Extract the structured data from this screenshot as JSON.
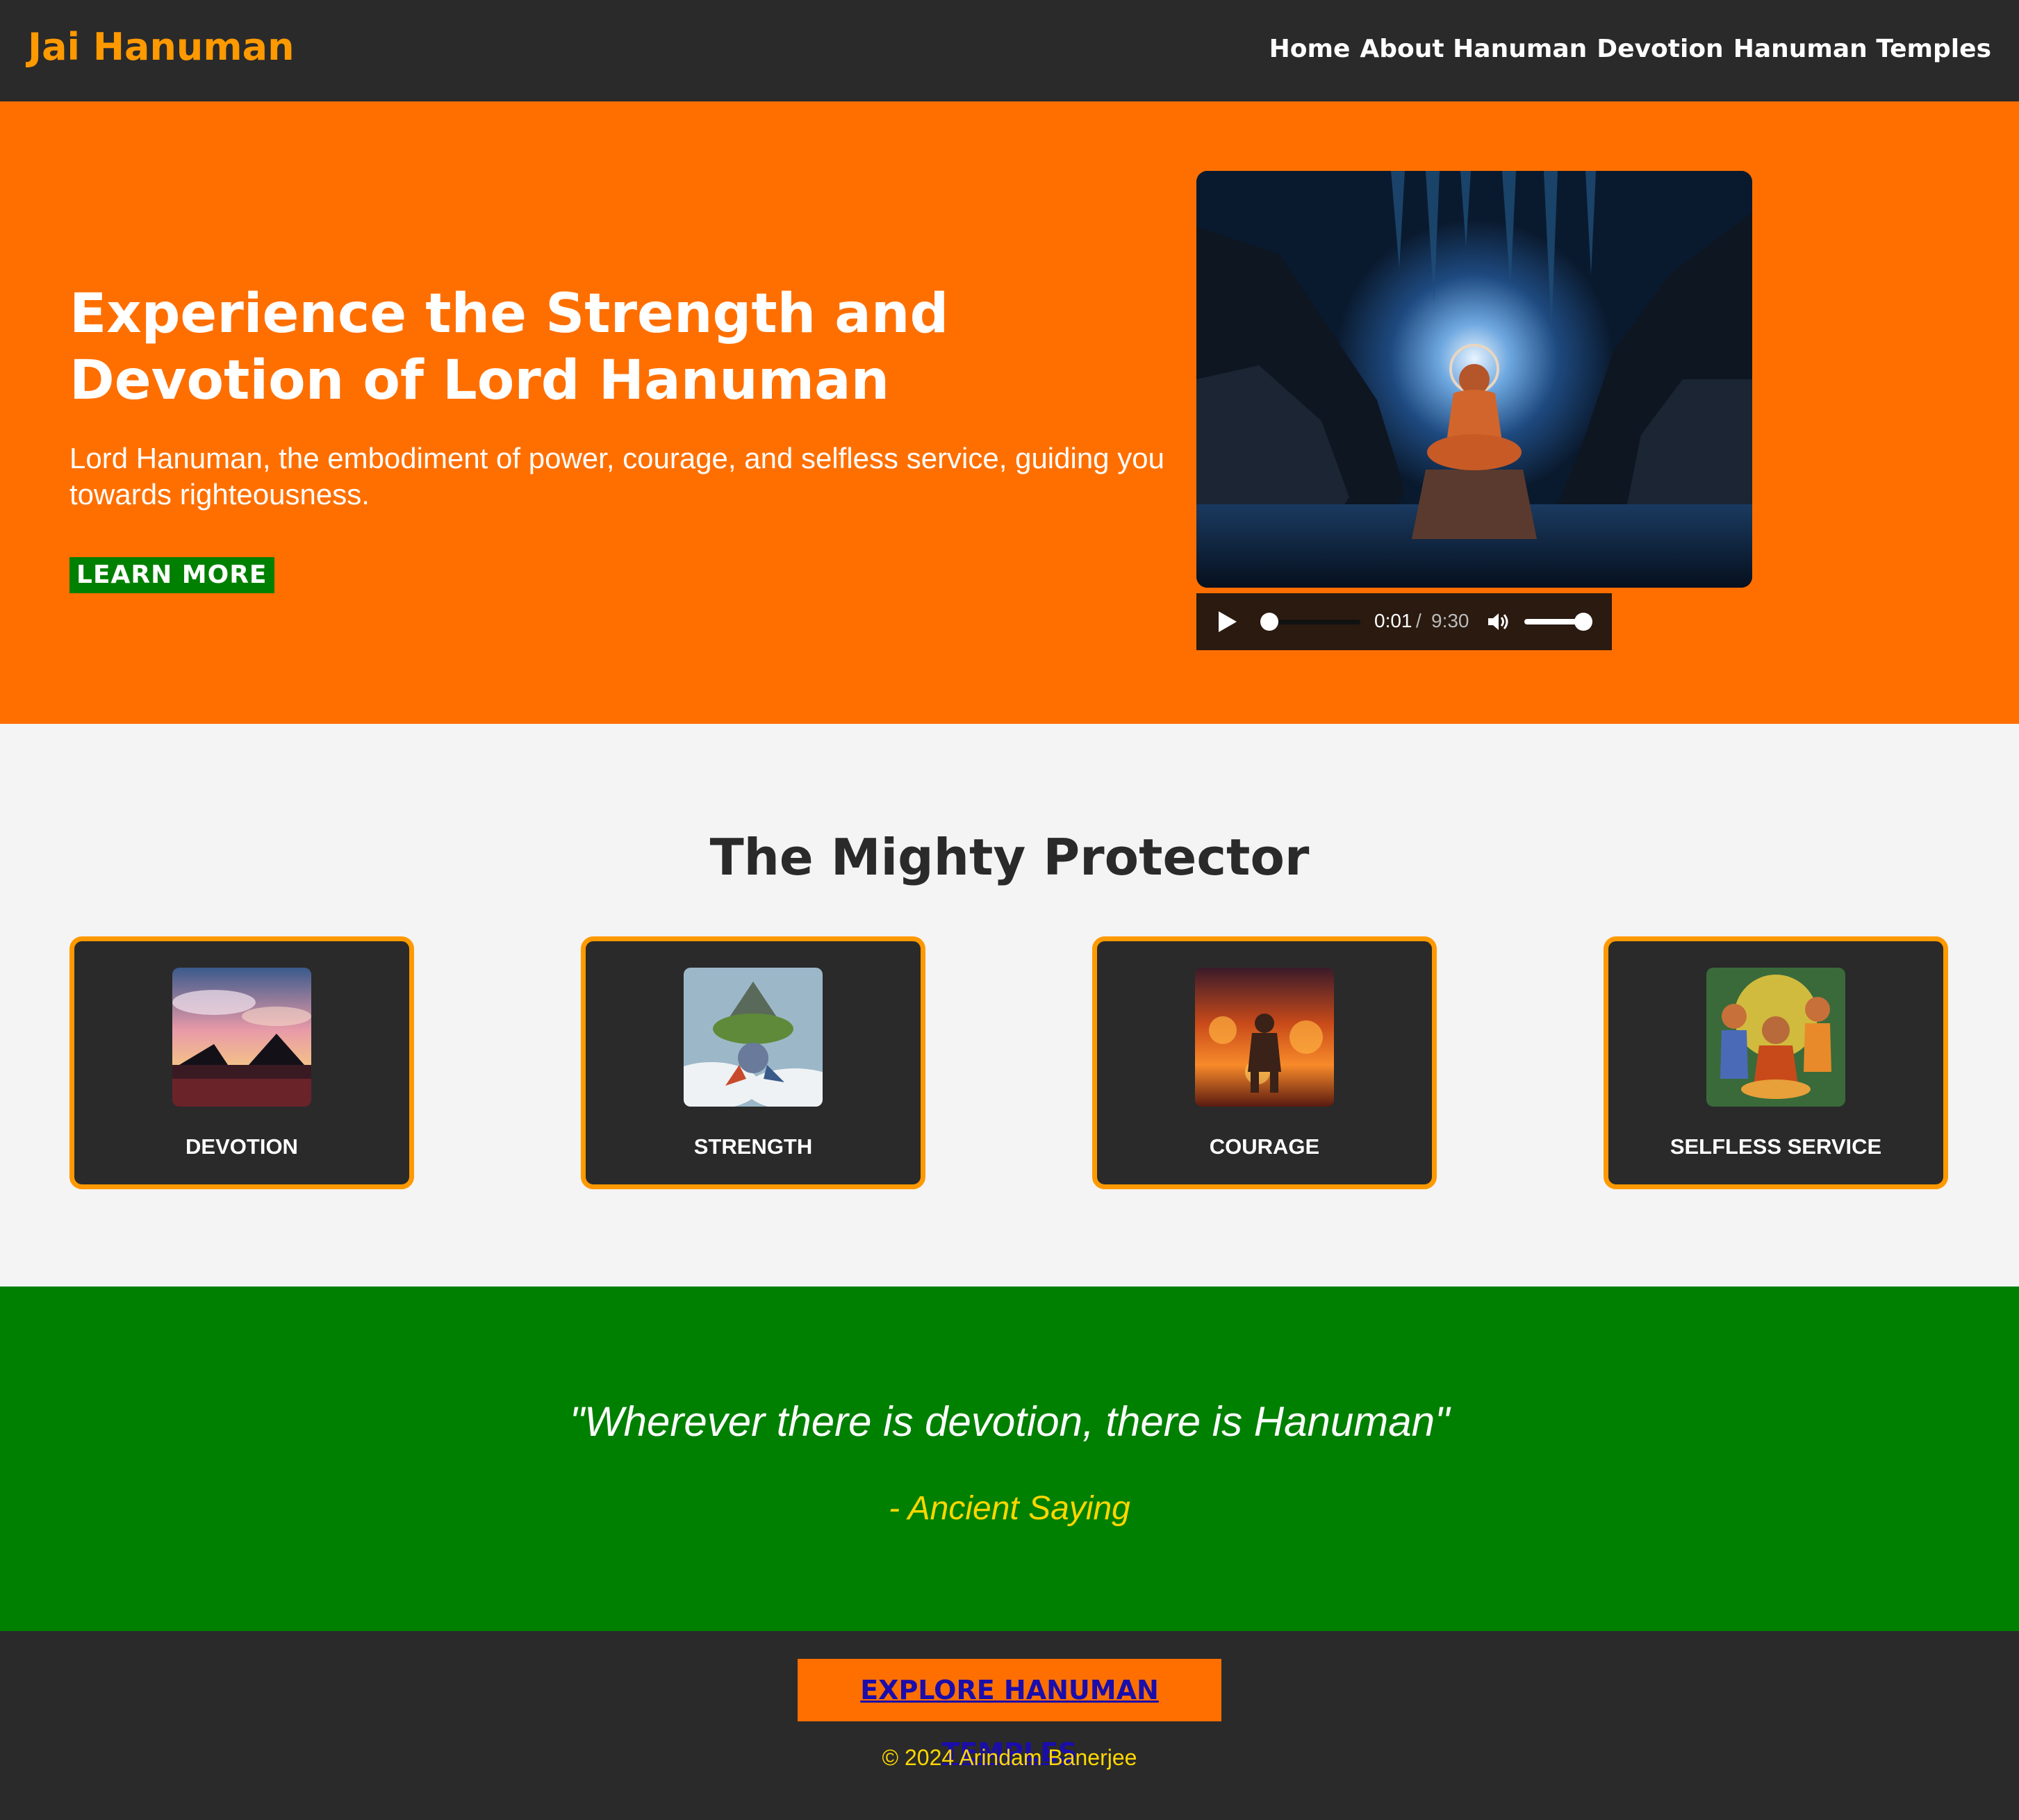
{
  "navbar": {
    "brand": "Jai Hanuman",
    "links": [
      "Home",
      "About Hanuman",
      "Devotion",
      "Hanuman Temples"
    ]
  },
  "hero": {
    "title": "Experience the Strength and Devotion of Lord Hanuman",
    "subtitle": "Lord Hanuman, the embodiment of power, courage, and selfless service, guiding you towards righteousness.",
    "button": "LEARN MORE",
    "video": {
      "current_time": "0:01",
      "separator": "/",
      "duration": "9:30",
      "progress_fraction": 0.002,
      "volume_fraction": 1.0
    }
  },
  "features": {
    "title": "The Mighty Protector",
    "cards": [
      {
        "label": "DEVOTION",
        "image": "devotion-image"
      },
      {
        "label": "STRENGTH",
        "image": "strength-image"
      },
      {
        "label": "COURAGE",
        "image": "courage-image"
      },
      {
        "label": "SELFLESS SERVICE",
        "image": "selfless-service-image"
      }
    ]
  },
  "quote": {
    "text": "\"Wherever there is devotion, there is Hanuman\"",
    "author": "- Ancient Saying"
  },
  "footer": {
    "button": "EXPLORE HANUMAN TEMPLES",
    "copyright": "© 2024 Arindam Banerjee"
  },
  "colors": {
    "nav_bg": "#2a2a2a",
    "brand": "#ff9900",
    "hero_bg": "#ff6f00",
    "accent_green": "#008000",
    "quote_author": "#ffd700",
    "link": "#1a0dab"
  }
}
